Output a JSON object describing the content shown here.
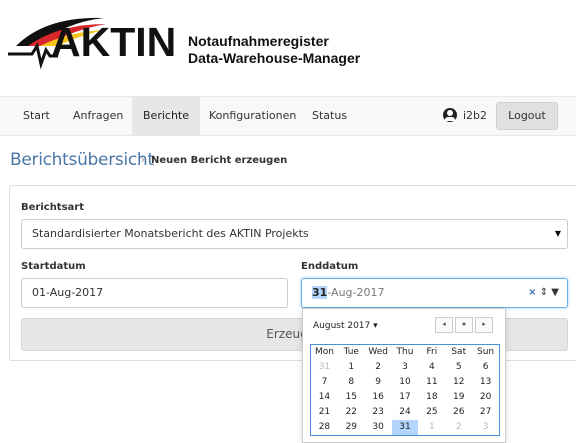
{
  "logo": {
    "text": "AKTIN",
    "alt": "AKTIN"
  },
  "app": {
    "title_line1": "Notaufnahmeregister",
    "title_line2": "Data-Warehouse-Manager"
  },
  "nav": {
    "items": [
      {
        "label": "Start",
        "active": false
      },
      {
        "label": "Anfragen",
        "active": false
      },
      {
        "label": "Berichte",
        "active": true
      },
      {
        "label": "Konfigurationen",
        "active": false
      },
      {
        "label": "Status",
        "active": false
      }
    ],
    "user": "i2b2",
    "logout_label": "Logout"
  },
  "breadcrumb": {
    "main": "Berichtsübersicht",
    "separator": "›",
    "current": "Neuen Bericht erzeugen"
  },
  "form": {
    "berichtsart_label": "Berichtsart",
    "berichtsart_value": "Standardisierter Monatsbericht des AKTIN Projekts",
    "startdatum_label": "Startdatum",
    "startdatum_value": "01-Aug-2017",
    "enddatum_label": "Enddatum",
    "enddatum_day": "31",
    "enddatum_rest": "-Aug-2017",
    "clear_symbol": "×",
    "spin_symbol": "⇕",
    "dropdown_symbol": "▼",
    "submit_label": "Erzeugen"
  },
  "calendar": {
    "month_label": "August 2017 ▾",
    "nav_prev": "◂",
    "nav_today": "●",
    "nav_next": "▸",
    "weekdays": [
      "Mon",
      "Tue",
      "Wed",
      "Thu",
      "Fri",
      "Sat",
      "Sun"
    ],
    "weeks": [
      [
        "31",
        "1",
        "2",
        "3",
        "4",
        "5",
        "6"
      ],
      [
        "7",
        "8",
        "9",
        "10",
        "11",
        "12",
        "13"
      ],
      [
        "14",
        "15",
        "16",
        "17",
        "18",
        "19",
        "20"
      ],
      [
        "21",
        "22",
        "23",
        "24",
        "25",
        "26",
        "27"
      ],
      [
        "28",
        "29",
        "30",
        "31",
        "1",
        "2",
        "3"
      ]
    ],
    "selected": "31",
    "colors": {
      "accent": "#4a76a8",
      "selected": "#b3d4fc",
      "grid_border": "#4a90d9"
    }
  }
}
